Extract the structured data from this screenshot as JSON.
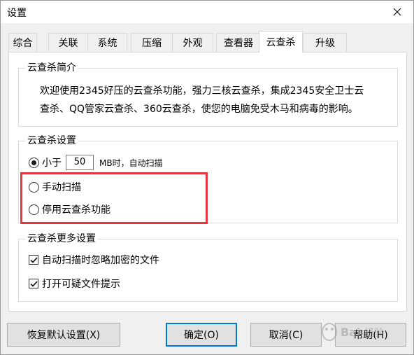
{
  "window": {
    "title": "设置"
  },
  "tabs": [
    {
      "label": "综合",
      "active": false
    },
    {
      "label": "关联",
      "active": false
    },
    {
      "label": "系统",
      "active": false
    },
    {
      "label": "压缩",
      "active": false
    },
    {
      "label": "外观",
      "active": false
    },
    {
      "label": "查看器",
      "active": false
    },
    {
      "label": "云查杀",
      "active": true
    },
    {
      "label": "升级",
      "active": false
    }
  ],
  "intro": {
    "title": "云查杀简介",
    "line1": "欢迎使用2345好压的云查杀功能，强力三核云查杀，集成2345安全卫士云",
    "line2": "查杀、QQ管家云查杀、360云查杀，使您的电脑免受木马和病毒的影响。"
  },
  "settings": {
    "title": "云查杀设置",
    "option_less_than": {
      "prefix": "小于",
      "value": "50",
      "suffix": "MB时，自动扫描",
      "checked": true
    },
    "option_manual": {
      "label": "手动扫描",
      "checked": false
    },
    "option_disable": {
      "label": "停用云查杀功能",
      "checked": false
    }
  },
  "more": {
    "title": "云查杀更多设置",
    "skip_encrypted": {
      "label": "自动扫描时忽略加密的文件",
      "checked": true
    },
    "suspicious_tip": {
      "label": "打开可疑文件提示",
      "checked": true
    }
  },
  "buttons": {
    "restore": "恢复默认设置(X)",
    "ok": "确定(O)",
    "cancel": "取消(C)",
    "help": "帮助(H)"
  },
  "colors": {
    "highlight": "#e8343e",
    "accent": "#0078d7"
  }
}
